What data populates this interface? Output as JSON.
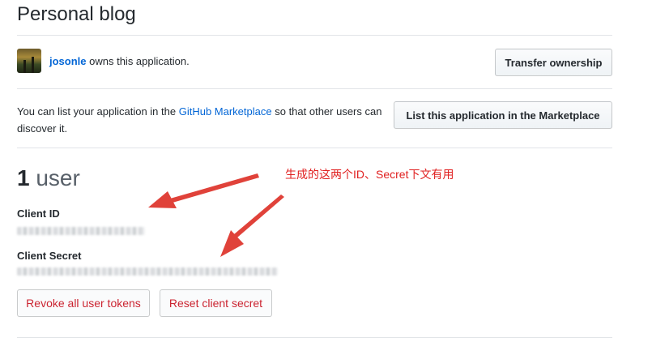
{
  "page": {
    "title": "Personal blog"
  },
  "owner": {
    "username": "josonle",
    "suffix": " owns this application."
  },
  "transfer_button": {
    "label": "Transfer ownership"
  },
  "marketplace": {
    "text_before": "You can list your application in the ",
    "link": "GitHub Marketplace",
    "text_after": " so that other users can discover it.",
    "button_label": "List this application in the Marketplace"
  },
  "users": {
    "count": "1",
    "unit": "user"
  },
  "client_id": {
    "label": "Client ID"
  },
  "client_secret": {
    "label": "Client Secret"
  },
  "actions": {
    "revoke_label": "Revoke all user tokens",
    "reset_label": "Reset client secret"
  },
  "annotation": {
    "text": "生成的这两个ID、Secret下文有用",
    "color": "#e02020"
  },
  "colors": {
    "link": "#0366d6",
    "danger": "#cb2431",
    "annotation": "#e02020"
  }
}
